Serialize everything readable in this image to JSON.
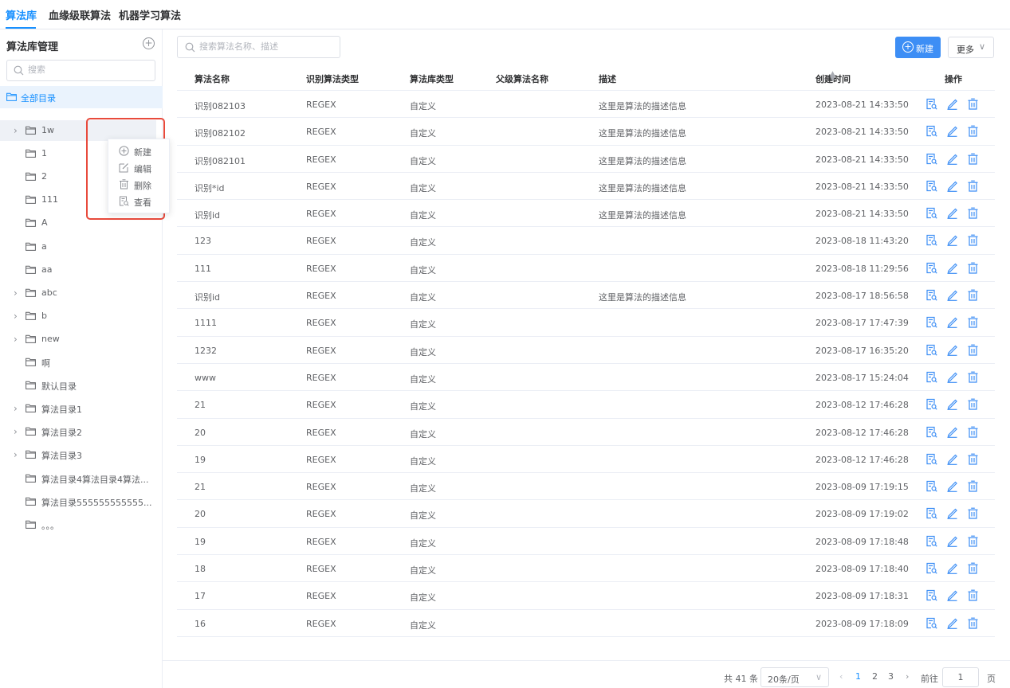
{
  "tabs": [
    "算法库",
    "血缘级联算法",
    "机器学习算法"
  ],
  "sidebar": {
    "title": "算法库管理",
    "search_placeholder": "搜索",
    "all_label": "全部目录",
    "items": [
      {
        "label": "1w",
        "expandable": true
      },
      {
        "label": "1",
        "expandable": false
      },
      {
        "label": "2",
        "expandable": false
      },
      {
        "label": "111",
        "expandable": false
      },
      {
        "label": "A",
        "expandable": false
      },
      {
        "label": "a",
        "expandable": false
      },
      {
        "label": "aa",
        "expandable": false
      },
      {
        "label": "abc",
        "expandable": true
      },
      {
        "label": "b",
        "expandable": true
      },
      {
        "label": "new",
        "expandable": true
      },
      {
        "label": "啊",
        "expandable": false
      },
      {
        "label": "默认目录",
        "expandable": false
      },
      {
        "label": "算法目录1",
        "expandable": true
      },
      {
        "label": "算法目录2",
        "expandable": true
      },
      {
        "label": "算法目录3",
        "expandable": true
      },
      {
        "label": "算法目录4算法目录4算法...",
        "expandable": false
      },
      {
        "label": "算法目录555555555555...",
        "expandable": false
      },
      {
        "label": "。。。",
        "expandable": false
      }
    ],
    "context_menu": [
      "新建",
      "编辑",
      "删除",
      "查看"
    ]
  },
  "toolbar": {
    "search_placeholder": "搜索算法名称、描述",
    "new_label": "新建",
    "more_label": "更多"
  },
  "table": {
    "columns": [
      "算法名称",
      "识别算法类型",
      "算法库类型",
      "父级算法名称",
      "描述",
      "创建时间",
      "操作"
    ],
    "rows": [
      [
        "识别082103",
        "REGEX",
        "自定义",
        "",
        "这里是算法的描述信息",
        "2023-08-21 14:33:50"
      ],
      [
        "识别082102",
        "REGEX",
        "自定义",
        "",
        "这里是算法的描述信息",
        "2023-08-21 14:33:50"
      ],
      [
        "识别082101",
        "REGEX",
        "自定义",
        "",
        "这里是算法的描述信息",
        "2023-08-21 14:33:50"
      ],
      [
        "识别*id",
        "REGEX",
        "自定义",
        "",
        "这里是算法的描述信息",
        "2023-08-21 14:33:50"
      ],
      [
        "识别id",
        "REGEX",
        "自定义",
        "",
        "这里是算法的描述信息",
        "2023-08-21 14:33:50"
      ],
      [
        "123",
        "REGEX",
        "自定义",
        "",
        "",
        "2023-08-18 11:43:20"
      ],
      [
        "111",
        "REGEX",
        "自定义",
        "",
        "",
        "2023-08-18 11:29:56"
      ],
      [
        "识别id",
        "REGEX",
        "自定义",
        "",
        "这里是算法的描述信息",
        "2023-08-17 18:56:58"
      ],
      [
        "1111",
        "REGEX",
        "自定义",
        "",
        "",
        "2023-08-17 17:47:39"
      ],
      [
        "1232",
        "REGEX",
        "自定义",
        "",
        "",
        "2023-08-17 16:35:20"
      ],
      [
        "www",
        "REGEX",
        "自定义",
        "",
        "",
        "2023-08-17 15:24:04"
      ],
      [
        "21",
        "REGEX",
        "自定义",
        "",
        "",
        "2023-08-12 17:46:28"
      ],
      [
        "20",
        "REGEX",
        "自定义",
        "",
        "",
        "2023-08-12 17:46:28"
      ],
      [
        "19",
        "REGEX",
        "自定义",
        "",
        "",
        "2023-08-12 17:46:28"
      ],
      [
        "21",
        "REGEX",
        "自定义",
        "",
        "",
        "2023-08-09 17:19:15"
      ],
      [
        "20",
        "REGEX",
        "自定义",
        "",
        "",
        "2023-08-09 17:19:02"
      ],
      [
        "19",
        "REGEX",
        "自定义",
        "",
        "",
        "2023-08-09 17:18:48"
      ],
      [
        "18",
        "REGEX",
        "自定义",
        "",
        "",
        "2023-08-09 17:18:40"
      ],
      [
        "17",
        "REGEX",
        "自定义",
        "",
        "",
        "2023-08-09 17:18:31"
      ],
      [
        "16",
        "REGEX",
        "自定义",
        "",
        "",
        "2023-08-09 17:18:09"
      ]
    ]
  },
  "pagination": {
    "total": "共 41 条",
    "page_size": "20条/页",
    "pages": [
      "1",
      "2",
      "3"
    ],
    "goto_label": "前往",
    "goto_value": "1",
    "page_suffix": "页"
  },
  "colors": {
    "accent": "#1890ff",
    "highlight_box": "#e84a3c"
  }
}
